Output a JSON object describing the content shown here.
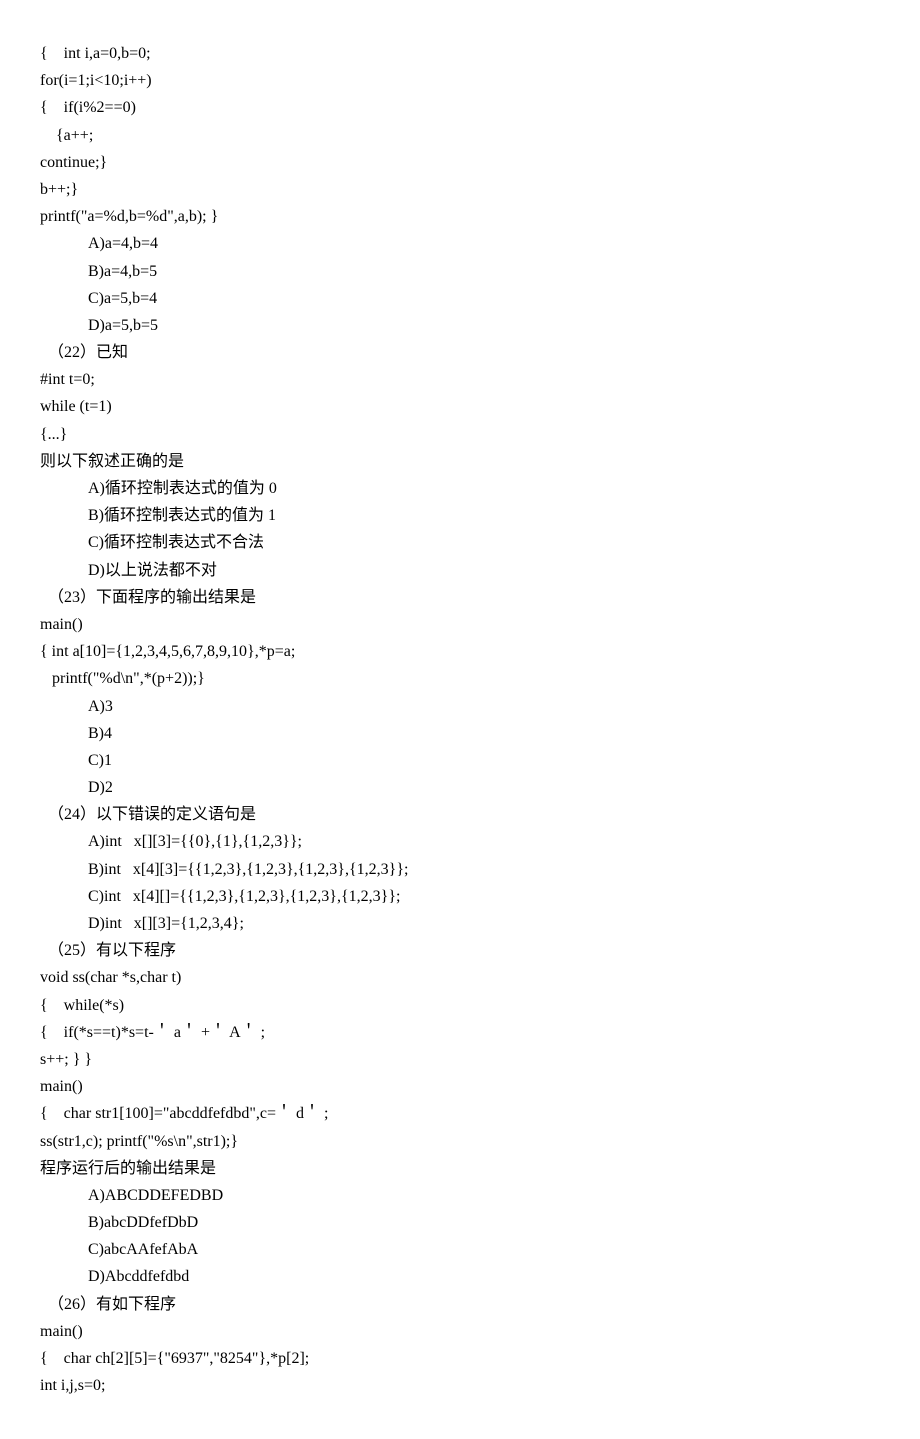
{
  "lines": [
    {
      "type": "line",
      "text": "{    int i,a=0,b=0;"
    },
    {
      "type": "line",
      "text": "for(i=1;i<10;i++)"
    },
    {
      "type": "line",
      "text": "{    if(i%2==0)"
    },
    {
      "type": "line",
      "text": "    {a++;"
    },
    {
      "type": "line",
      "text": "continue;}"
    },
    {
      "type": "line",
      "text": "b++;}"
    },
    {
      "type": "line",
      "text": "printf(\"a=%d,b=%d\",a,b); }"
    },
    {
      "type": "option",
      "text": "A)a=4,b=4"
    },
    {
      "type": "option",
      "text": "B)a=4,b=5"
    },
    {
      "type": "option",
      "text": "C)a=5,b=4"
    },
    {
      "type": "option",
      "text": "D)a=5,b=5"
    },
    {
      "type": "line",
      "text": "  （22）已知"
    },
    {
      "type": "line",
      "text": "#int t=0;"
    },
    {
      "type": "line",
      "text": "while (t=1)"
    },
    {
      "type": "line",
      "text": "{...}"
    },
    {
      "type": "line",
      "text": "则以下叙述正确的是"
    },
    {
      "type": "option",
      "text": "A)循环控制表达式的值为 0"
    },
    {
      "type": "option",
      "text": "B)循环控制表达式的值为 1"
    },
    {
      "type": "option",
      "text": "C)循环控制表达式不合法"
    },
    {
      "type": "option",
      "text": "D)以上说法都不对"
    },
    {
      "type": "line",
      "text": "  （23）下面程序的输出结果是"
    },
    {
      "type": "line",
      "text": "main()"
    },
    {
      "type": "line",
      "text": "{ int a[10]={1,2,3,4,5,6,7,8,9,10},*p=a;"
    },
    {
      "type": "line",
      "text": "   printf(\"%d\\n\",*(p+2));}"
    },
    {
      "type": "option",
      "text": "A)3"
    },
    {
      "type": "option",
      "text": "B)4"
    },
    {
      "type": "option",
      "text": "C)1"
    },
    {
      "type": "option",
      "text": "D)2"
    },
    {
      "type": "line",
      "text": "  （24）以下错误的定义语句是"
    },
    {
      "type": "option",
      "text": "A)int   x[][3]={{0},{1},{1,2,3}};"
    },
    {
      "type": "option",
      "text": "B)int   x[4][3]={{1,2,3},{1,2,3},{1,2,3},{1,2,3}};"
    },
    {
      "type": "option",
      "text": "C)int   x[4][]={{1,2,3},{1,2,3},{1,2,3},{1,2,3}};"
    },
    {
      "type": "option",
      "text": "D)int   x[][3]={1,2,3,4};"
    },
    {
      "type": "line",
      "text": "  （25）有以下程序"
    },
    {
      "type": "line",
      "text": "void ss(char *s,char t)"
    },
    {
      "type": "line",
      "text": "{    while(*s)"
    },
    {
      "type": "line",
      "text": "{    if(*s==t)*s=t-＇ a＇ +＇ A＇ ;"
    },
    {
      "type": "line",
      "text": "s++; } }"
    },
    {
      "type": "line",
      "text": "main()"
    },
    {
      "type": "line",
      "text": "{    char str1[100]=\"abcddfefdbd\",c=＇ d＇ ;"
    },
    {
      "type": "line",
      "text": "ss(str1,c); printf(\"%s\\n\",str1);}"
    },
    {
      "type": "line",
      "text": "程序运行后的输出结果是"
    },
    {
      "type": "option",
      "text": "A)ABCDDEFEDBD"
    },
    {
      "type": "option",
      "text": "B)abcDDfefDbD"
    },
    {
      "type": "option",
      "text": "C)abcAAfefAbA"
    },
    {
      "type": "option",
      "text": "D)Abcddfefdbd"
    },
    {
      "type": "line",
      "text": "  （26）有如下程序"
    },
    {
      "type": "line",
      "text": "main()"
    },
    {
      "type": "line",
      "text": "{    char ch[2][5]={\"6937\",\"8254\"},*p[2];"
    },
    {
      "type": "line",
      "text": "int i,j,s=0;"
    }
  ]
}
